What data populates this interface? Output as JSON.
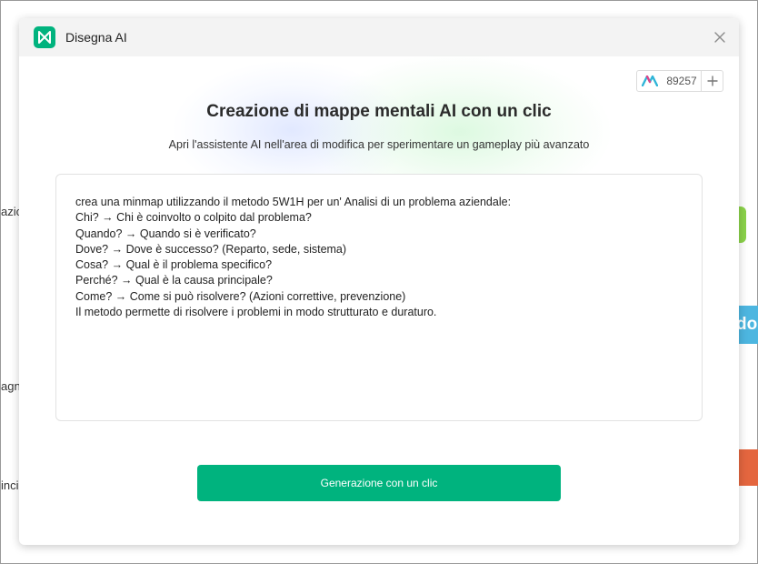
{
  "background": {
    "left_texts": [
      "azio",
      "agn",
      "inci"
    ],
    "blue_node_text": "do"
  },
  "dialog": {
    "title": "Disegna AI",
    "logo_icon": "mindmap-logo-icon",
    "credits": {
      "count": "89257",
      "add_symbol": "+"
    },
    "heading": "Creazione di mappe mentali AI con un clic",
    "subheading": "Apri l'assistente AI nell'area di modifica per sperimentare un gameplay più avanzato",
    "prompt_lines": [
      "crea una minmap utilizzando il metodo 5W1H per un' Analisi di un problema aziendale:",
      "Chi? → Chi è coinvolto o colpito dal problema?",
      "Quando? → Quando si è verificato?",
      "Dove? → Dove è successo? (Reparto, sede, sistema)",
      "Cosa? → Qual è il problema specifico?",
      "Perché? → Qual è la causa principale?",
      "Come? → Come si può risolvere? (Azioni correttive, prevenzione)",
      "Il metodo permette di risolvere i problemi in modo strutturato e duraturo."
    ],
    "generate_label": "Generazione con un clic"
  },
  "colors": {
    "accent": "#00b37e",
    "bg_node_green": "#8bd34a",
    "bg_node_blue": "#4db6e0",
    "bg_node_orange": "#e4663f"
  }
}
